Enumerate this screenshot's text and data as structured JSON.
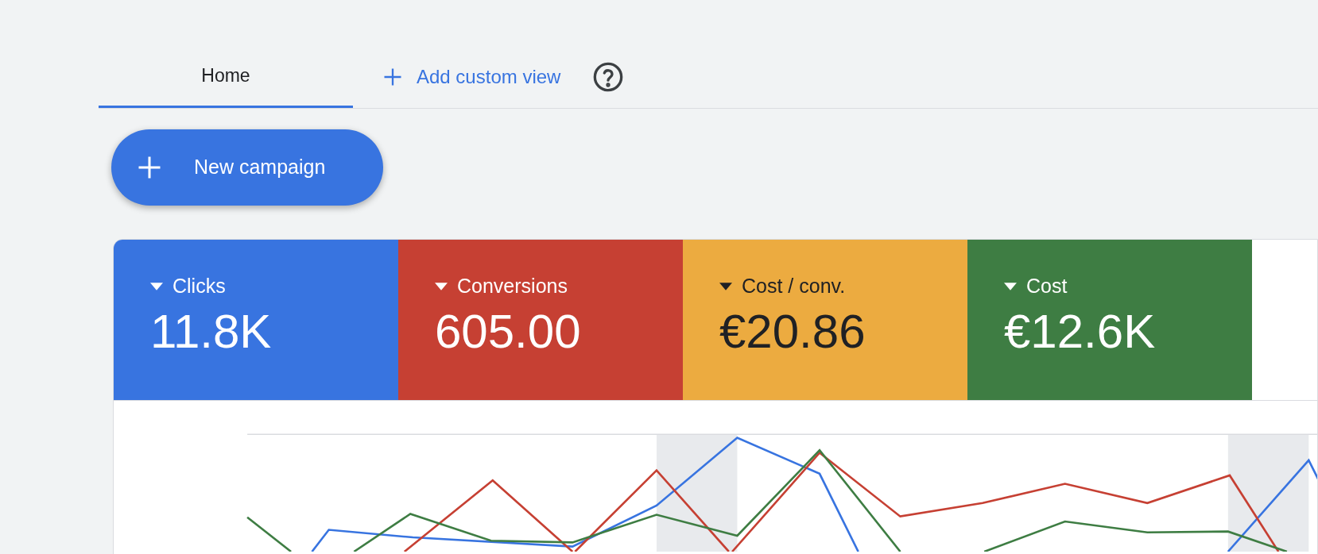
{
  "tabs": [
    {
      "label": "Home",
      "selected": true
    }
  ],
  "add_view": {
    "label": "Add custom view"
  },
  "new_campaign": {
    "label": "New campaign"
  },
  "metrics": [
    {
      "label": "Clicks",
      "value": "11.8K",
      "color": "#3874e0"
    },
    {
      "label": "Conversions",
      "value": "605.00",
      "color": "#c64033"
    },
    {
      "label": "Cost / conv.",
      "value": "€20.86",
      "color": "#ecab40"
    },
    {
      "label": "Cost",
      "value": "€12.6K",
      "color": "#3e7d43"
    }
  ]
}
